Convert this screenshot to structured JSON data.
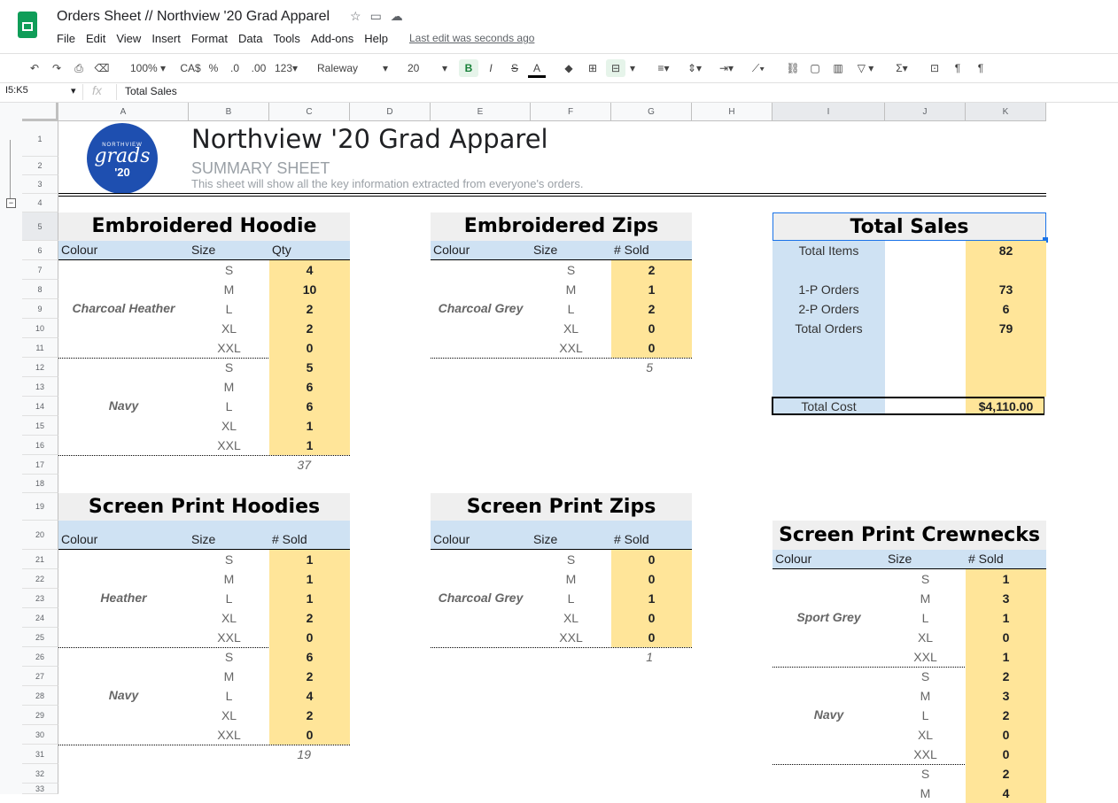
{
  "app": {
    "title": "Orders Sheet // Northview '20 Grad Apparel",
    "menu": [
      "File",
      "Edit",
      "View",
      "Insert",
      "Format",
      "Data",
      "Tools",
      "Add-ons",
      "Help"
    ],
    "last_edit": "Last edit was seconds ago"
  },
  "toolbar": {
    "zoom": "100%",
    "currency": "CA$",
    "percent": "%",
    "dec_less": ".0",
    "dec_more": ".00",
    "format_more": "123",
    "font": "Raleway",
    "font_size": "20",
    "bold": "B",
    "italic": "I",
    "strike": "S",
    "text_color": "A"
  },
  "formula_bar": {
    "name_box": "I5:K5",
    "fx": "fx",
    "value": "Total Sales"
  },
  "columns": [
    "A",
    "B",
    "C",
    "D",
    "E",
    "F",
    "G",
    "H",
    "I",
    "J",
    "K"
  ],
  "rows": [
    "1",
    "2",
    "3",
    "4",
    "5",
    "6",
    "7",
    "8",
    "9",
    "10",
    "11",
    "12",
    "13",
    "14",
    "15",
    "16",
    "17",
    "18",
    "19",
    "20",
    "21",
    "22",
    "23",
    "24",
    "25",
    "26",
    "27",
    "28",
    "29",
    "30",
    "31",
    "32",
    "33"
  ],
  "header": {
    "logo_top": "NORTHVIEW",
    "logo_main": "grads",
    "logo_year": "'20",
    "title": "Northview '20 Grad Apparel",
    "subtitle": "SUMMARY SHEET",
    "description": "This sheet will show all the key information extracted from everyone's orders."
  },
  "sections": {
    "emb_hoodie": {
      "title": "Embroidered Hoodie",
      "headers": [
        "Colour",
        "Size",
        "Qty"
      ],
      "groups": [
        {
          "colour": "Charcoal Heather",
          "sizes": [
            "S",
            "M",
            "L",
            "XL",
            "XXL"
          ],
          "qty": [
            "4",
            "10",
            "2",
            "2",
            "0"
          ]
        },
        {
          "colour": "Navy",
          "sizes": [
            "S",
            "M",
            "L",
            "XL",
            "XXL"
          ],
          "qty": [
            "5",
            "6",
            "6",
            "1",
            "1"
          ]
        }
      ],
      "total": "37"
    },
    "emb_zips": {
      "title": "Embroidered Zips",
      "headers": [
        "Colour",
        "Size",
        "# Sold"
      ],
      "groups": [
        {
          "colour": "Charcoal Grey",
          "sizes": [
            "S",
            "M",
            "L",
            "XL",
            "XXL"
          ],
          "qty": [
            "2",
            "1",
            "2",
            "0",
            "0"
          ]
        }
      ],
      "total": "5"
    },
    "sp_hoodies": {
      "title": "Screen Print Hoodies",
      "headers": [
        "Colour",
        "Size",
        "# Sold"
      ],
      "groups": [
        {
          "colour": "Heather",
          "sizes": [
            "S",
            "M",
            "L",
            "XL",
            "XXL"
          ],
          "qty": [
            "1",
            "1",
            "1",
            "2",
            "0"
          ]
        },
        {
          "colour": "Navy",
          "sizes": [
            "S",
            "M",
            "L",
            "XL",
            "XXL"
          ],
          "qty": [
            "6",
            "2",
            "4",
            "2",
            "0"
          ]
        }
      ],
      "total": "19"
    },
    "sp_zips": {
      "title": "Screen Print Zips",
      "headers": [
        "Colour",
        "Size",
        "# Sold"
      ],
      "groups": [
        {
          "colour": "Charcoal Grey",
          "sizes": [
            "S",
            "M",
            "L",
            "XL",
            "XXL"
          ],
          "qty": [
            "0",
            "0",
            "1",
            "0",
            "0"
          ]
        }
      ],
      "total": "1"
    },
    "sp_crewnecks": {
      "title": "Screen Print Crewnecks",
      "headers": [
        "Colour",
        "Size",
        "# Sold"
      ],
      "groups": [
        {
          "colour": "Sport Grey",
          "sizes": [
            "S",
            "M",
            "L",
            "XL",
            "XXL"
          ],
          "qty": [
            "1",
            "3",
            "1",
            "0",
            "1"
          ]
        },
        {
          "colour": "Navy",
          "sizes": [
            "S",
            "M",
            "L",
            "XL",
            "XXL"
          ],
          "qty": [
            "2",
            "3",
            "2",
            "0",
            "0"
          ]
        },
        {
          "colour": "",
          "sizes": [
            "S",
            "M"
          ],
          "qty": [
            "2",
            "4"
          ]
        }
      ]
    },
    "total_sales": {
      "title": "Total Sales",
      "items": [
        {
          "label": "Total Items",
          "value": "82"
        },
        {
          "label": "1-P Orders",
          "value": "73"
        },
        {
          "label": "2-P Orders",
          "value": "6"
        },
        {
          "label": "Total Orders",
          "value": "79"
        }
      ],
      "cost_label": "Total Cost",
      "cost_value": "$4,110.00"
    }
  }
}
